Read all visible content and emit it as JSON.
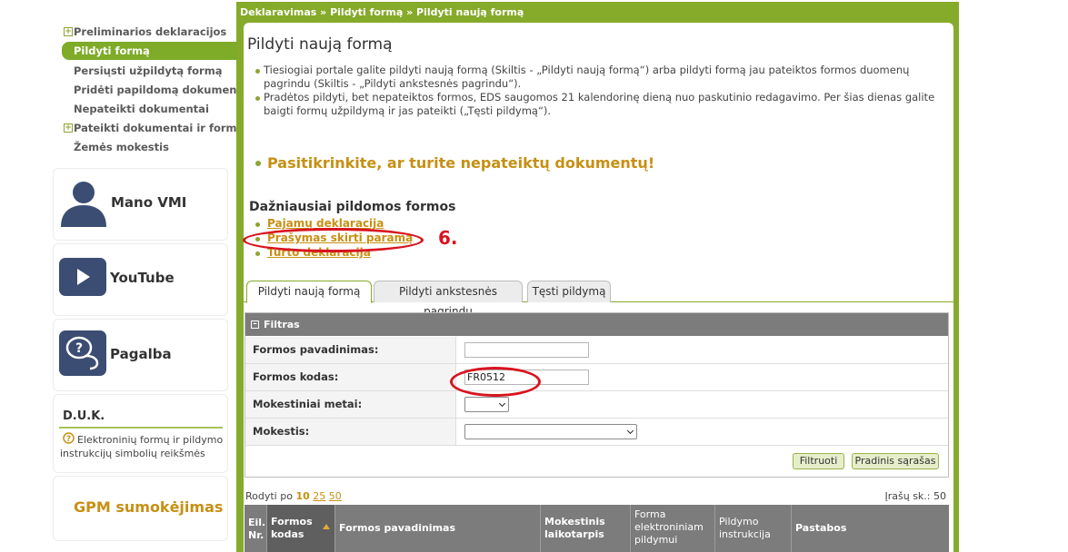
{
  "breadcrumb": {
    "text": "Deklaravimas » Pildyti formą » Pildyti naują formą"
  },
  "sidebar": {
    "items": [
      {
        "label": "Preliminarios deklaracijos",
        "expandable": true,
        "active": false
      },
      {
        "label": "Pildyti formą",
        "expandable": false,
        "active": true
      },
      {
        "label": "Persiųsti užpildytą formą",
        "expandable": false,
        "active": false
      },
      {
        "label": "Pridėti papildomą dokumentą",
        "expandable": false,
        "active": false
      },
      {
        "label": "Nepateikti dokumentai",
        "expandable": false,
        "active": false
      },
      {
        "label": "Pateikti dokumentai ir formos",
        "expandable": true,
        "active": false
      },
      {
        "label": "Žemės mokestis",
        "expandable": false,
        "active": false
      }
    ],
    "tiles": {
      "mano_vmi": "Mano VMI",
      "youtube": "YouTube",
      "pagalba": "Pagalba"
    },
    "duk": {
      "title": "D.U.K.",
      "link": "Elektroninių formų ir pildymo instrukcijų simbolių reikšmės"
    },
    "gpm": "GPM sumokėjimas"
  },
  "main": {
    "title": "Pildyti naują formą",
    "info": [
      "Tiesiogiai portale galite pildyti naują formą (Skiltis - „Pildyti naują formą“) arba pildyti formą jau pateiktos formos duomenų pagrindu (Skiltis - „Pildyti ankstesnės pagrindu“).",
      "Pradėtos pildyti, bet nepateiktos formos, EDS saugomos 21 kalendorinę dieną nuo paskutinio redagavimo. Per šias dienas galite baigti formų užpildymą ir jas pateikti („Tęsti pildymą“)."
    ],
    "check_link": "Pasitikrinkite, ar turite nepateiktų dokumentų!",
    "frequent_title": "Dažniausiai pildomos formos",
    "frequent_links": [
      "Pajamų deklaracija",
      "Prašymas skirti paramą",
      "Turto deklaracija"
    ],
    "annotation_step": "6.",
    "tabs": [
      {
        "label": "Pildyti naują formą",
        "active": true
      },
      {
        "label": "Pildyti ankstesnės pagrindu",
        "active": false
      },
      {
        "label": "Tęsti pildymą",
        "active": false
      }
    ],
    "filter": {
      "title": "Filtras",
      "fields": {
        "name_label": "Formos pavadinimas:",
        "name_value": "",
        "code_label": "Formos kodas:",
        "code_value": "FR0512",
        "year_label": "Mokestiniai metai:",
        "year_value": "",
        "tax_label": "Mokestis:",
        "tax_value": ""
      },
      "filter_button": "Filtruoti",
      "reset_button": "Pradinis sąrašas"
    },
    "pager": {
      "prefix": "Rodyti po",
      "current": "10",
      "options": [
        "25",
        "50"
      ]
    },
    "records": "Įrašų sk.: 50",
    "table_headers": [
      "Eil. Nr.",
      "Formos kodas",
      "Formos pavadinimas",
      "Mokestinis laikotarpis",
      "Forma elektroniniam pildymui",
      "Pildymo instrukcija",
      "Pastabos"
    ]
  },
  "colors": {
    "brand_green": "#86aa2a",
    "link_gold": "#c79013",
    "annotation_red": "#d8141f",
    "header_grey": "#7c7c7c"
  }
}
